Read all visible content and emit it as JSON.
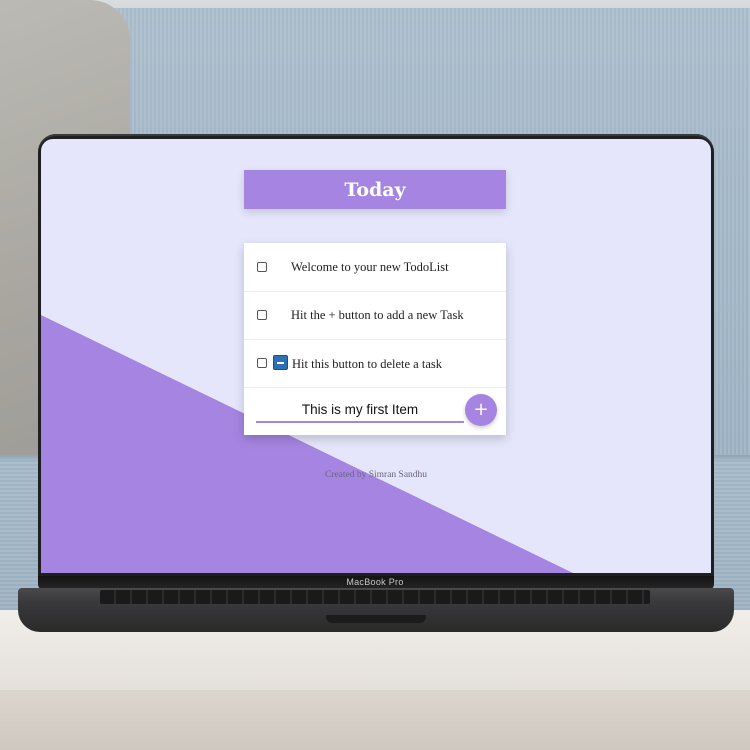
{
  "device": {
    "brand_label": "MacBook Pro"
  },
  "app": {
    "title": "Today",
    "items": [
      {
        "text": "Welcome to your new TodoList",
        "checked": false
      },
      {
        "text": "Hit the + button to add a new Task",
        "checked": false
      },
      {
        "text": "Hit this button to delete a task",
        "checked": false,
        "icon": "delete-icon"
      }
    ],
    "new_item": {
      "value": "This is my first Item",
      "add_label": "+"
    },
    "footer": "Created by Simran Sandhu"
  },
  "colors": {
    "accent": "#a585e1",
    "screen_background": "#e5e6fb",
    "card_background": "#ffffff"
  }
}
